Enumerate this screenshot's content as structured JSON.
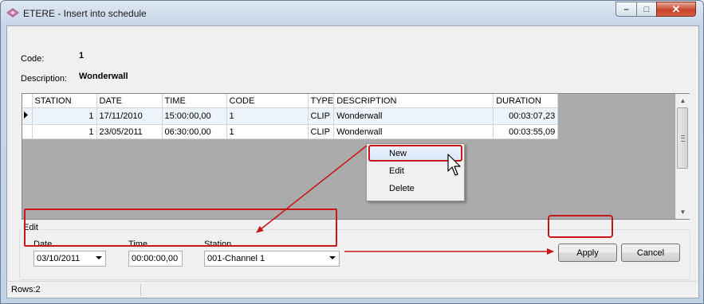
{
  "window": {
    "title": "ETERE - Insert into schedule"
  },
  "header": {
    "code_label": "Code:",
    "code_value": "1",
    "description_label": "Description:",
    "description_value": "Wonderwall"
  },
  "grid": {
    "columns": [
      "STATION",
      "DATE",
      "TIME",
      "CODE",
      "TYPE",
      "DESCRIPTION",
      "DURATION"
    ],
    "rows": [
      {
        "station": "1",
        "date": "17/11/2010",
        "time": "15:00:00,00",
        "code": "1",
        "type": "CLIP",
        "description": "Wonderwall",
        "duration": "00:03:07,23"
      },
      {
        "station": "1",
        "date": "23/05/2011",
        "time": "06:30:00,00",
        "code": "1",
        "type": "CLIP",
        "description": "Wonderwall",
        "duration": "00:03:55,09"
      }
    ]
  },
  "context_menu": {
    "items": [
      "New",
      "Edit",
      "Delete"
    ]
  },
  "edit": {
    "group_title": "Edit",
    "date_label": "Date",
    "date_value": "03/10/2011",
    "time_label": "Time",
    "time_value": "00:00:00,00",
    "station_label": "Station",
    "station_value": "001-Channel 1"
  },
  "buttons": {
    "apply": "Apply",
    "cancel": "Cancel"
  },
  "status": {
    "rows": "Rows:2"
  },
  "colors": {
    "highlight": "#c8171b"
  }
}
